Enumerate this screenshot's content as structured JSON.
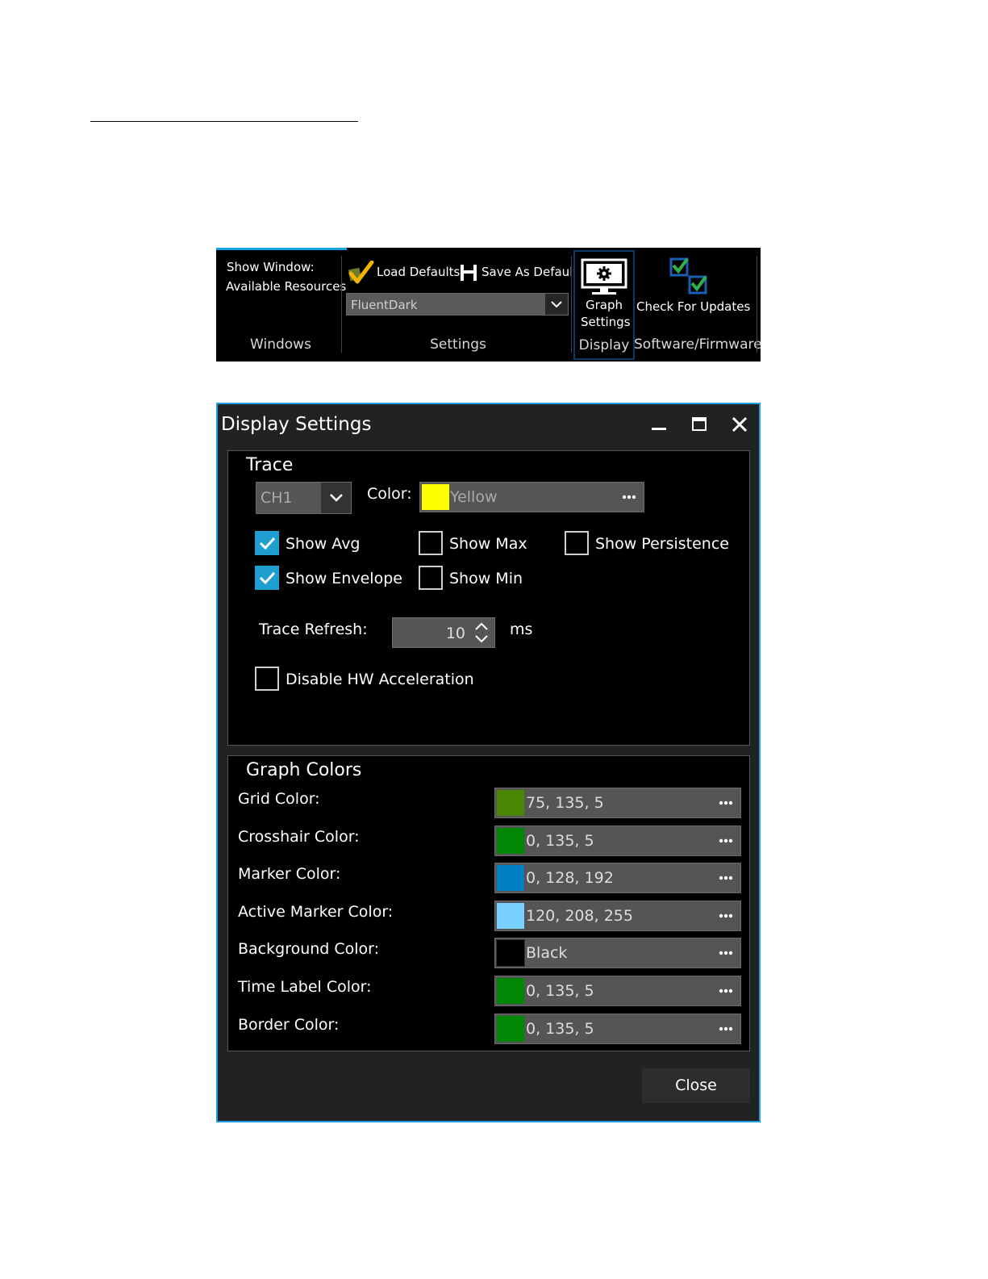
{
  "ribbon": {
    "windows": {
      "line1": "Show Window:",
      "line2": "Available Resources",
      "group_label": "Windows"
    },
    "settings": {
      "load_defaults": "Load Defaults",
      "save_as_default": "Save As Default",
      "theme_value": "FluentDark",
      "group_label": "Settings"
    },
    "display": {
      "graph_line1": "Graph",
      "graph_line2": "Settings",
      "group_label": "Display"
    },
    "software": {
      "check_updates": "Check For Updates",
      "group_label": "Software/Firmware"
    }
  },
  "dialog": {
    "title": "Display Settings",
    "trace": {
      "title": "Trace",
      "channel_value": "CH1",
      "color_label": "Color:",
      "color_value": "Yellow",
      "color_hex": "#ffff00",
      "show_avg": {
        "label": "Show Avg",
        "checked": true
      },
      "show_max": {
        "label": "Show Max",
        "checked": false
      },
      "show_persistence": {
        "label": "Show Persistence",
        "checked": false
      },
      "show_envelope": {
        "label": "Show Envelope",
        "checked": true
      },
      "show_min": {
        "label": "Show Min",
        "checked": false
      },
      "refresh_label": "Trace Refresh:",
      "refresh_value": "10",
      "refresh_unit": "ms",
      "disable_hw": {
        "label": "Disable HW Acceleration",
        "checked": false
      }
    },
    "graph_colors": {
      "title": "Graph Colors",
      "rows": [
        {
          "label": "Grid Color:",
          "value": "75, 135, 5",
          "swatch": "#4b8705"
        },
        {
          "label": "Crosshair Color:",
          "value": "0, 135, 5",
          "swatch": "#008705"
        },
        {
          "label": "Marker Color:",
          "value": "0, 128, 192",
          "swatch": "#0080c0"
        },
        {
          "label": "Active Marker Color:",
          "value": "120, 208, 255",
          "swatch": "#78d0ff"
        },
        {
          "label": "Background Color:",
          "value": "Black",
          "swatch": "#000000"
        },
        {
          "label": "Time Label Color:",
          "value": "0, 135, 5",
          "swatch": "#008705"
        },
        {
          "label": "Border Color:",
          "value": "0, 135, 5",
          "swatch": "#008705"
        }
      ]
    },
    "close_label": "Close"
  },
  "colors": {
    "accent": "#1ba1e2",
    "check_fill": "#1f9fd0"
  }
}
